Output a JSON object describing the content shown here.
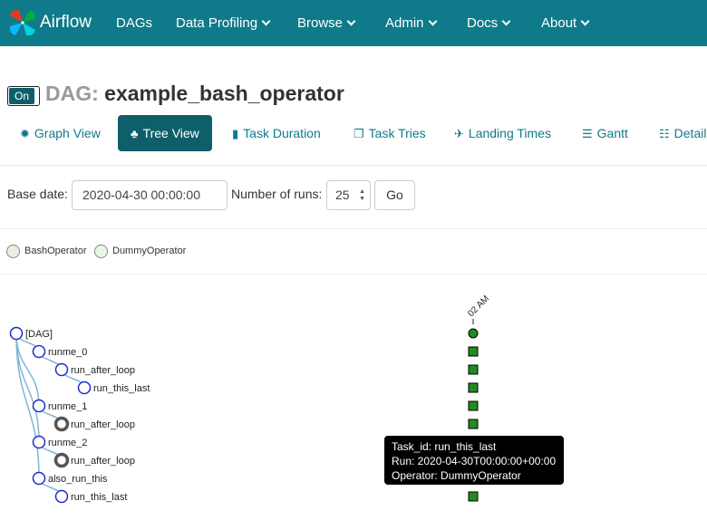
{
  "navbar": {
    "brand": "Airflow",
    "items": [
      {
        "label": "DAGs",
        "dropdown": false
      },
      {
        "label": "Data Profiling",
        "dropdown": true
      },
      {
        "label": "Browse",
        "dropdown": true
      },
      {
        "label": "Admin",
        "dropdown": true
      },
      {
        "label": "Docs",
        "dropdown": true
      },
      {
        "label": "About",
        "dropdown": true
      }
    ]
  },
  "header": {
    "toggle_label": "On",
    "title_prefix": "DAG:",
    "dag_id": "example_bash_operator"
  },
  "tabs": [
    {
      "label": "Graph View",
      "icon": "asterisk-icon",
      "active": false
    },
    {
      "label": "Tree View",
      "icon": "tree-icon",
      "active": true
    },
    {
      "label": "Task Duration",
      "icon": "bar-chart-icon",
      "active": false
    },
    {
      "label": "Task Tries",
      "icon": "duplicate-icon",
      "active": false
    },
    {
      "label": "Landing Times",
      "icon": "plane-icon",
      "active": false
    },
    {
      "label": "Gantt",
      "icon": "align-left-icon",
      "active": false
    },
    {
      "label": "Details",
      "icon": "list-icon",
      "active": false
    }
  ],
  "form": {
    "base_date_label": "Base date:",
    "base_date_value": "2020-04-30 00:00:00",
    "num_runs_label": "Number of runs:",
    "num_runs_value": "25",
    "go_label": "Go"
  },
  "legend": [
    {
      "label": "BashOperator",
      "color": "#f0ede4"
    },
    {
      "label": "DummyOperator",
      "color": "#e8f7e4"
    }
  ],
  "tree": {
    "column_label": "02 AM",
    "nodes": [
      {
        "label": "[DAG]",
        "depth": 0,
        "collapsed": false,
        "state": "success"
      },
      {
        "label": "runme_0",
        "depth": 1,
        "collapsed": false,
        "state": "success"
      },
      {
        "label": "run_after_loop",
        "depth": 2,
        "collapsed": false,
        "state": "success"
      },
      {
        "label": "run_this_last",
        "depth": 3,
        "collapsed": false,
        "state": "success"
      },
      {
        "label": "runme_1",
        "depth": 1,
        "collapsed": false,
        "state": "success"
      },
      {
        "label": "run_after_loop",
        "depth": 2,
        "collapsed": true,
        "state": "success"
      },
      {
        "label": "runme_2",
        "depth": 1,
        "collapsed": false,
        "state": "success"
      },
      {
        "label": "run_after_loop",
        "depth": 2,
        "collapsed": true,
        "state": "success"
      },
      {
        "label": "also_run_this",
        "depth": 1,
        "collapsed": false,
        "state": "success"
      },
      {
        "label": "run_this_last",
        "depth": 2,
        "collapsed": false,
        "state": "success"
      }
    ],
    "colors": {
      "node_stroke": "#1b2ccf",
      "link": "#7fb6d6",
      "success": "#218c21",
      "collapsed": "#555555"
    }
  },
  "tooltip": {
    "task_id": "Task_id: run_this_last",
    "run": "Run: 2020-04-30T00:00:00+00:00",
    "operator": "Operator: DummyOperator"
  }
}
